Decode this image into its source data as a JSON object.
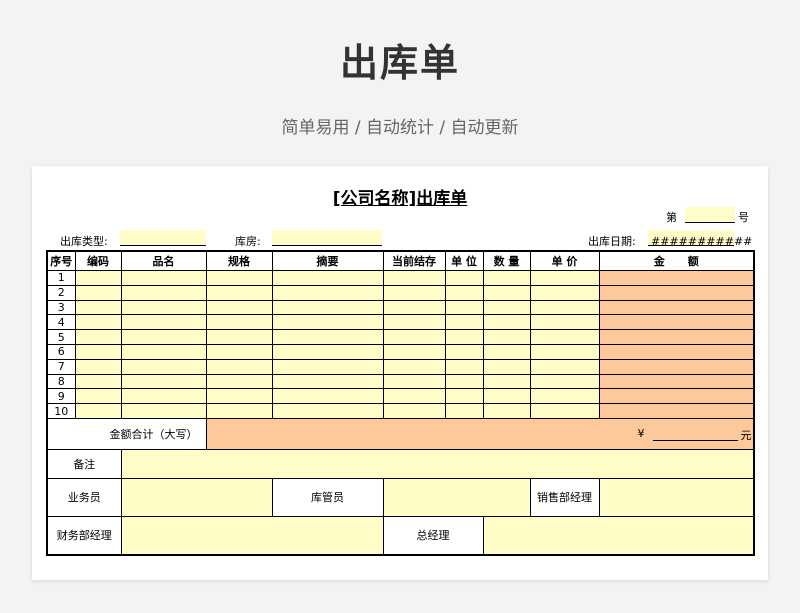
{
  "hero": {
    "title": "出库单",
    "subtitle": "简单易用 / 自动统计 / 自动更新"
  },
  "doc": {
    "title": "[公司名称]出库单",
    "number_prefix": "第",
    "number_suffix": "号",
    "out_type_label": "出库类型:",
    "warehouse_label": "库房:",
    "date_label": "出库日期:",
    "date_value": "###########"
  },
  "table": {
    "headers": [
      "序号",
      "编码",
      "品名",
      "规格",
      "摘要",
      "当前结存",
      "单 位",
      "数 量",
      "单 价",
      "金      额"
    ],
    "rows": [
      "1",
      "2",
      "3",
      "4",
      "5",
      "6",
      "7",
      "8",
      "9",
      "10"
    ],
    "total_label": "金额合计（大写）",
    "yen_symbol": "¥",
    "yuan": "元",
    "remark_label": "备注",
    "salesman_label": "业务员",
    "keeper_label": "库管员",
    "sales_manager_label": "销售部经理",
    "finance_manager_label": "财务部经理",
    "general_manager_label": "总经理"
  },
  "colors": {
    "input_fill": "#fffcc8",
    "amount_fill": "#fec99a"
  }
}
